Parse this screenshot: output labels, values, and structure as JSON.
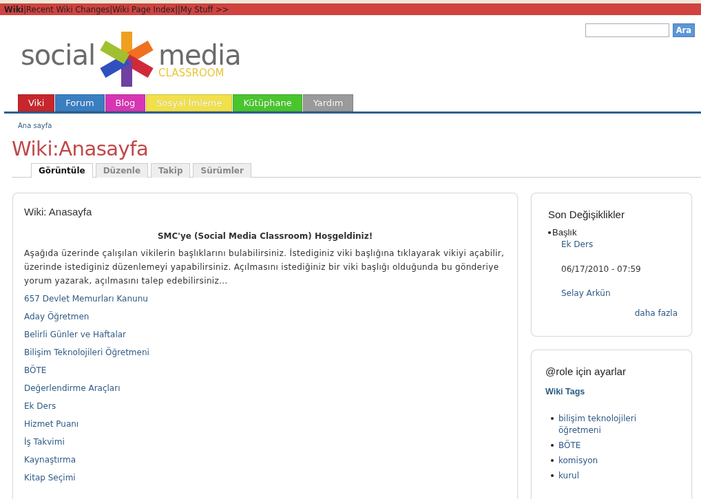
{
  "top_bar": [
    {
      "kind": "link",
      "label": "Wiki",
      "selected": true
    },
    {
      "kind": "separator",
      "label": "|"
    },
    {
      "kind": "link",
      "label": "Recent Wiki Changes",
      "selected": false
    },
    {
      "kind": "separator",
      "label": "|"
    },
    {
      "kind": "link",
      "label": "Wiki Page Index",
      "selected": false
    },
    {
      "kind": "separator",
      "label": "||"
    },
    {
      "kind": "link",
      "label": "My Stuff >>",
      "selected": false
    }
  ],
  "search": {
    "button": "Ara"
  },
  "logo": {
    "word1": "social",
    "word2": "media",
    "tagline": "CLASSROOM"
  },
  "nav": [
    {
      "label": "Viki",
      "color": "#c8262b"
    },
    {
      "label": "Forum",
      "color": "#3a7ec2"
    },
    {
      "label": "Blog",
      "color": "#d835b4"
    },
    {
      "label": "Sosyal İmleme",
      "color": "#f2e04a"
    },
    {
      "label": "Kütüphane",
      "color": "#49c52d"
    },
    {
      "label": "Yardım",
      "color": "#9a9a9a"
    }
  ],
  "breadcrumb": "Ana sayfa",
  "page_title": "Wiki:Anasayfa",
  "tabs": [
    {
      "label": "Görüntüle",
      "selected": true
    },
    {
      "label": "Düzenle",
      "selected": false
    },
    {
      "label": "Takip",
      "selected": false
    },
    {
      "label": "Sürümler",
      "selected": false
    }
  ],
  "main": {
    "title": "Wiki: Anasayfa",
    "welcome": "SMC'ye (Social Media Classroom) Hoşgeldiniz!",
    "intro": "Aşağıda üzerinde çalışılan vikilerin başlıklarını bulabilirsiniz. İstediginiz viki başlığına tıklayarak vikiyi açabilir, üzerinde istediginiz düzenlemeyi yapabilirsiniz. Açılmasını istediğiniz bir viki başlığı olduğunda bu gönderiye yorum yazarak, açılmasını talep edebilirsiniz...",
    "links": [
      "657 Devlet Memurları Kanunu",
      "Aday Öğretmen",
      "Belirli Günler ve Haftalar",
      "Bilişim Teknolojileri Öğretmeni",
      "BÖTE",
      "Değerlendirme Araçları",
      "Ek Ders",
      "Hizmet Puanı",
      "İş Takvimi",
      "Kaynaştırma",
      "Kitap Seçimi"
    ]
  },
  "recent": {
    "title": "Son Değişiklikler",
    "heading": "Başlık",
    "page": "Ek Ders",
    "date": "06/17/2010 - 07:59",
    "author": "Selay Arkün",
    "more": "daha fazla"
  },
  "settings": {
    "title": "@role için ayarlar",
    "subtitle": "Wiki Tags",
    "tags": [
      "bilişim teknolojileri öğretmeni",
      "BÖTE",
      "komisyon",
      "kurul"
    ]
  }
}
